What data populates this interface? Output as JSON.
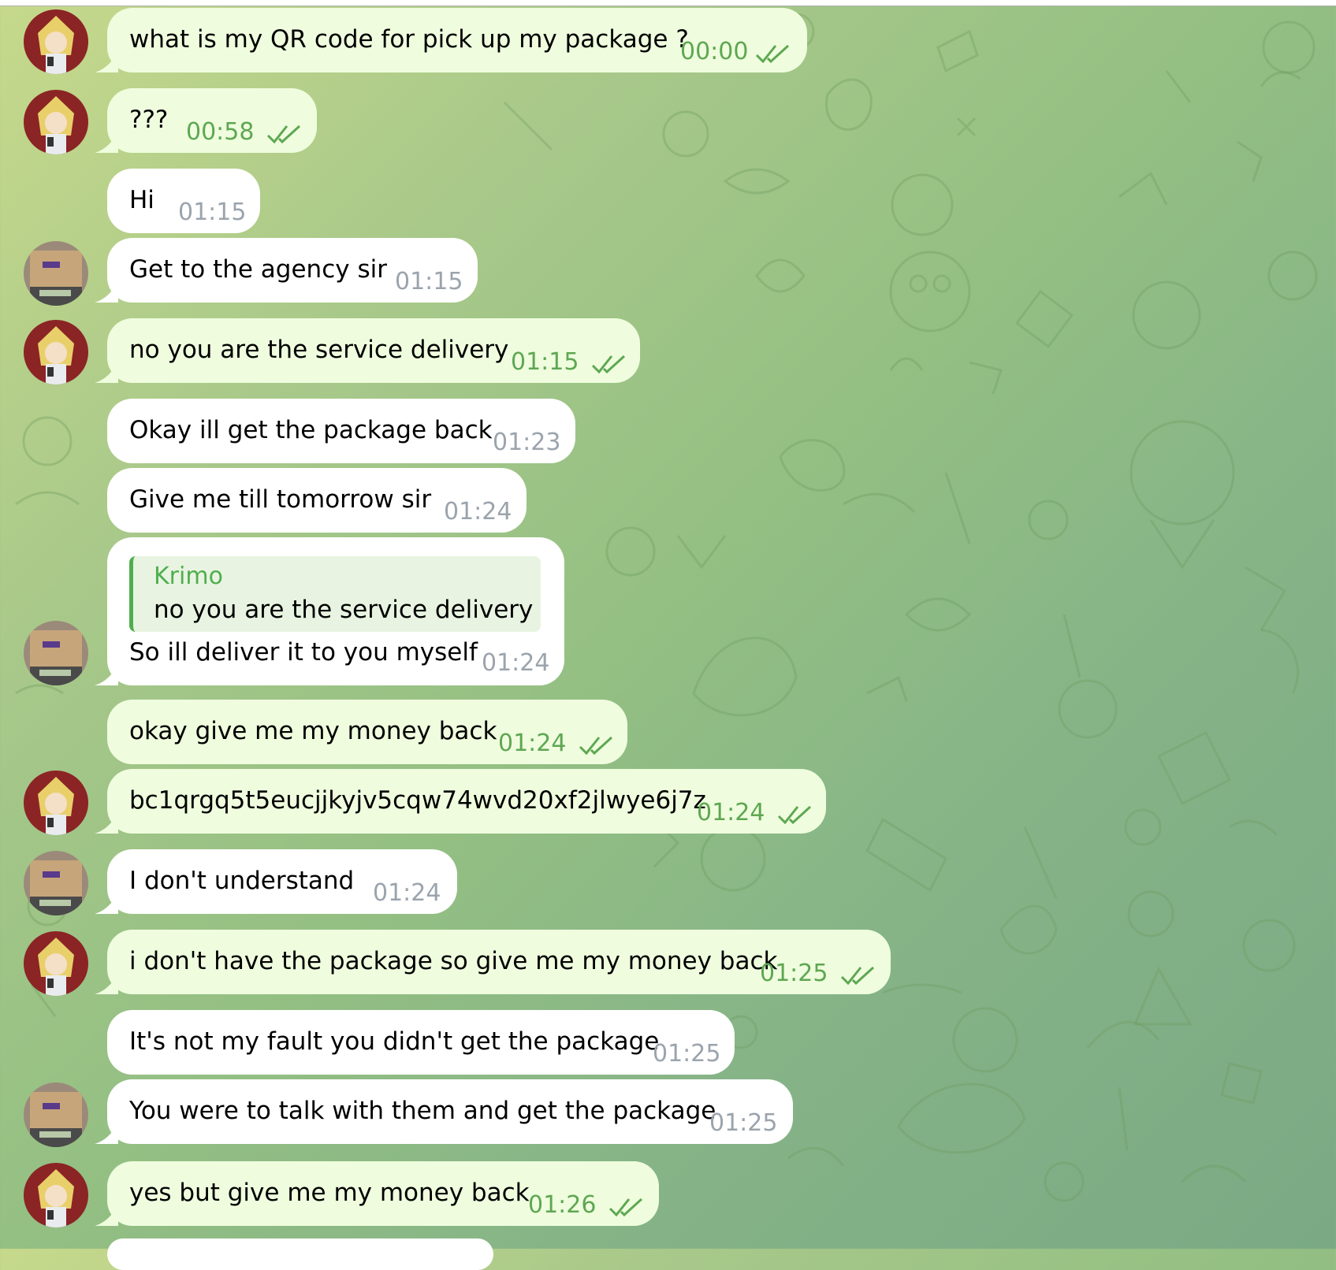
{
  "theme": {
    "outgoing_bubble": "#effdde",
    "incoming_bubble": "#ffffff",
    "outgoing_time_color": "#5ea752",
    "incoming_time_color": "#9ba4ad",
    "reply_accent": "#4fae4e"
  },
  "messages": [
    {
      "direction": "out",
      "text": "what is my QR code for pick up my package ?",
      "time": "00:00",
      "read": true,
      "avatar": "anime-avatar"
    },
    {
      "direction": "out",
      "text": "???",
      "time": "00:58",
      "read": true,
      "avatar": "anime-avatar"
    },
    {
      "direction": "in",
      "text": "Hi",
      "time": "01:15"
    },
    {
      "direction": "in",
      "text": "Get to the agency sir",
      "time": "01:15",
      "avatar": "package-avatar"
    },
    {
      "direction": "out",
      "text": "no you are the service delivery",
      "time": "01:15",
      "read": true,
      "avatar": "anime-avatar"
    },
    {
      "direction": "in",
      "text": "Okay ill get the package back",
      "time": "01:23"
    },
    {
      "direction": "in",
      "text": "Give me till tomorrow sir",
      "time": "01:24"
    },
    {
      "direction": "in",
      "text": "So ill deliver it to you myself",
      "time": "01:24",
      "avatar": "package-avatar",
      "reply": {
        "name": "Krimo",
        "text": "no you are the service delivery"
      }
    },
    {
      "direction": "out",
      "text": "okay give me my money back",
      "time": "01:24",
      "read": true
    },
    {
      "direction": "out",
      "text": "bc1qrgq5t5eucjjkyjv5cqw74wvd20xf2jlwye6j7z",
      "time": "01:24",
      "read": true,
      "avatar": "anime-avatar"
    },
    {
      "direction": "in",
      "text": "I don't understand",
      "time": "01:24",
      "avatar": "package-avatar"
    },
    {
      "direction": "out",
      "text": "i don't have the package so give me my money back",
      "time": "01:25",
      "read": true,
      "avatar": "anime-avatar"
    },
    {
      "direction": "in",
      "text": "It's not my fault you didn't get the package",
      "time": "01:25"
    },
    {
      "direction": "in",
      "text": "You were to talk with them and get the package",
      "time": "01:25",
      "avatar": "package-avatar"
    },
    {
      "direction": "out",
      "text": "yes but give me my money back",
      "time": "01:26",
      "read": true,
      "avatar": "anime-avatar"
    }
  ]
}
